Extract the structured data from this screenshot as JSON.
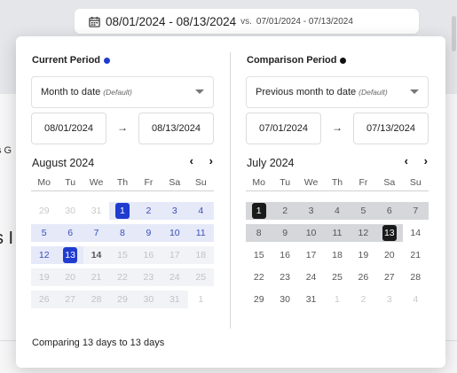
{
  "background": {
    "fragment_1": "s G",
    "fragment_2": "s I"
  },
  "trigger": {
    "icon": "calendar-icon",
    "main_range": "08/01/2024 - 08/13/2024",
    "vs_label": "vs.",
    "compare_range": "07/01/2024 - 07/13/2024"
  },
  "current": {
    "title": "Current Period",
    "dot_color": "#1f3ccf",
    "preset": "Month to date",
    "preset_default": "(Default)",
    "start": "08/01/2024",
    "end": "08/13/2024",
    "month": "August 2024",
    "weekdays": [
      "Mo",
      "Tu",
      "We",
      "Th",
      "Fr",
      "Sa",
      "Su"
    ],
    "weeks": [
      [
        "29",
        "30",
        "31",
        "1",
        "2",
        "3",
        "4"
      ],
      [
        "5",
        "6",
        "7",
        "8",
        "9",
        "10",
        "11"
      ],
      [
        "12",
        "13",
        "14",
        "15",
        "16",
        "17",
        "18"
      ],
      [
        "19",
        "20",
        "21",
        "22",
        "23",
        "24",
        "25"
      ],
      [
        "26",
        "27",
        "28",
        "29",
        "30",
        "31",
        "1"
      ]
    ]
  },
  "comparison": {
    "title": "Comparison Period",
    "dot_color": "#111111",
    "preset": "Previous month to date",
    "preset_default": "(Default)",
    "start": "07/01/2024",
    "end": "07/13/2024",
    "month": "July 2024",
    "weekdays": [
      "Mo",
      "Tu",
      "We",
      "Th",
      "Fr",
      "Sa",
      "Su"
    ],
    "weeks": [
      [
        "1",
        "2",
        "3",
        "4",
        "5",
        "6",
        "7"
      ],
      [
        "8",
        "9",
        "10",
        "11",
        "12",
        "13",
        "14"
      ],
      [
        "15",
        "16",
        "17",
        "18",
        "19",
        "20",
        "21"
      ],
      [
        "22",
        "23",
        "24",
        "25",
        "26",
        "27",
        "28"
      ],
      [
        "29",
        "30",
        "31",
        "1",
        "2",
        "3",
        "4"
      ]
    ]
  },
  "nav": {
    "prev": "‹",
    "next": "›"
  },
  "arrow": "→",
  "footer": "Comparing 13 days to 13 days",
  "colors": {
    "accent": "#1f3ccf",
    "compare": "#1a1a1a"
  }
}
